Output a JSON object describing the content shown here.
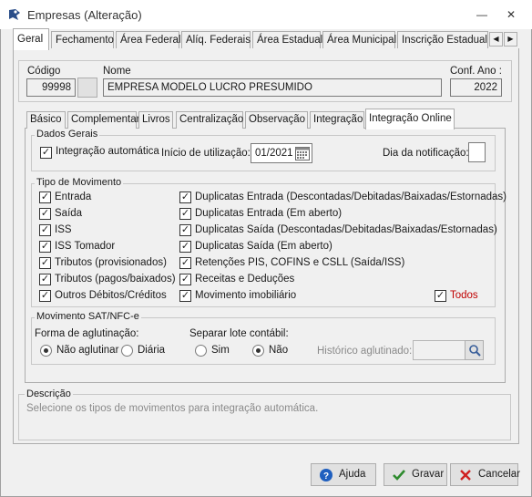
{
  "window": {
    "title": "Empresas (Alteração)"
  },
  "titlebar_buttons": {
    "minimize": "—",
    "close": "✕"
  },
  "top_tabs": [
    "Geral",
    "Fechamento",
    "Área Federal",
    "Alíq. Federais",
    "Área Estadual",
    "Área Municipal",
    "Inscrição Estadual S"
  ],
  "tab_scroll": {
    "left": "◀",
    "right": "▶"
  },
  "header": {
    "codigo_label": "Código",
    "codigo_value": "99998",
    "nome_label": "Nome",
    "nome_value": "EMPRESA MODELO LUCRO PRESUMIDO",
    "conf_ano_label": "Conf. Ano :",
    "conf_ano_value": "2022"
  },
  "inner_tabs": [
    "Básico",
    "Complementar",
    "Livros",
    "Centralização",
    "Observação",
    "Integração",
    "Integração Online"
  ],
  "dados_gerais": {
    "legend": "Dados Gerais",
    "integracao_label": "Integração automática",
    "integracao_checked": true,
    "inicio_label": "Início de utilização:",
    "inicio_value": "01/2021",
    "dia_label": "Dia da notificação:",
    "dia_value": ""
  },
  "tipo_movimento": {
    "legend": "Tipo de Movimento",
    "left_items": [
      "Entrada",
      "Saída",
      "ISS",
      "ISS Tomador",
      "Tributos (provisionados)",
      "Tributos (pagos/baixados)",
      "Outros Débitos/Créditos"
    ],
    "right_items": [
      "Duplicatas Entrada (Descontadas/Debitadas/Baixadas/Estornadas)",
      "Duplicatas Entrada (Em aberto)",
      "Duplicatas Saída (Descontadas/Debitadas/Baixadas/Estornadas)",
      "Duplicatas Saída (Em aberto)",
      "Retenções PIS, COFINS e CSLL (Saída/ISS)",
      "Receitas e Deduções",
      "Movimento imobiliário"
    ],
    "todos_label": "Todos",
    "todos_color": "#c00000",
    "check_mark": "✓"
  },
  "sat": {
    "legend": "Movimento SAT/NFC-e",
    "forma_label": "Forma de aglutinação:",
    "forma_options": [
      "Não aglutinar",
      "Diária"
    ],
    "forma_selected": "Não aglutinar",
    "separar_label": "Separar lote contábil:",
    "separar_options": [
      "Sim",
      "Não"
    ],
    "separar_selected": "Não",
    "historico_label": "Histórico aglutinado:",
    "historico_value": ""
  },
  "descricao": {
    "legend": "Descrição",
    "text": "Selecione os tipos de movimentos para integração automática."
  },
  "buttons": {
    "ajuda": "Ajuda",
    "gravar": "Gravar",
    "cancelar": "Cancelar"
  },
  "colors": {
    "accent_blue": "#1f5fbf",
    "green": "#2e8b2e",
    "red": "#d02020"
  }
}
